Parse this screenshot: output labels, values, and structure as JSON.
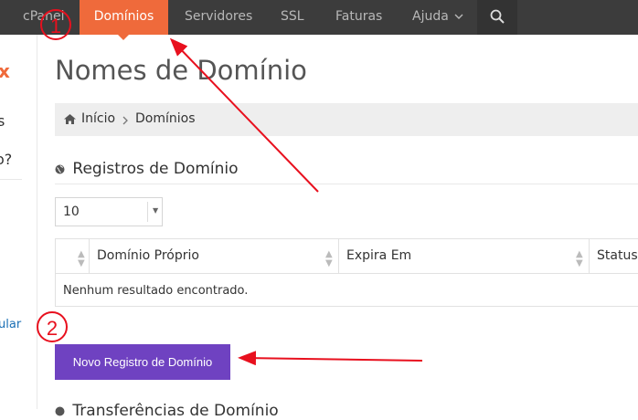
{
  "nav": {
    "items": [
      "cPanel",
      "Domínios",
      "Servidores",
      "SSL",
      "Faturas",
      "Ajuda"
    ],
    "active": "Domínios"
  },
  "sidebar": {
    "fragments": [
      "x",
      "s",
      "o?",
      "ular"
    ]
  },
  "page": {
    "title": "Nomes de Domínio"
  },
  "breadcrumb": {
    "items": [
      "Início",
      "Domínios"
    ]
  },
  "section": {
    "title": "Registros de Domínio"
  },
  "table": {
    "page_size": "10",
    "columns": [
      "Domínio Próprio",
      "Expira Em",
      "Status"
    ],
    "empty_message": "Nenhum resultado encontrado."
  },
  "actions": {
    "new_registration": "Novo Registro de Domínio"
  },
  "next_section": {
    "title": "Transferências de Domínio"
  },
  "annotations": {
    "marker_1": "1",
    "marker_2": "2",
    "color": "#e8101e"
  },
  "colors": {
    "nav_bg": "#3c3c3c",
    "active_tab": "#ef6a3b",
    "primary_button": "#6f42c1",
    "breadcrumb_bg": "#eeeeee"
  }
}
